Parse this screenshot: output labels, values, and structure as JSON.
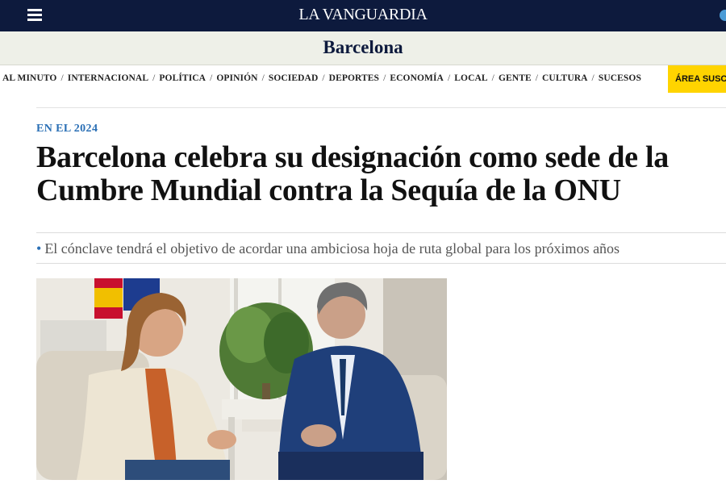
{
  "header": {
    "brand": "LA VANGUARDIA",
    "menu_icon": "hamburger-menu-icon",
    "user_icon": "user-account-icon",
    "bar_color": "#0d1a3d"
  },
  "section": {
    "title": "Barcelona"
  },
  "nav": {
    "items": [
      "AL MINUTO",
      "INTERNACIONAL",
      "POLÍTICA",
      "OPINIÓN",
      "SOCIEDAD",
      "DEPORTES",
      "ECONOMÍA",
      "LOCAL",
      "GENTE",
      "CULTURA",
      "SUCESOS"
    ],
    "separator": "/",
    "cta": "ÁREA SUSC",
    "cta_color": "#ffd400"
  },
  "article": {
    "kicker": "EN EL 2024",
    "headline": "Barcelona celebra su designación como sede de la Cumbre Mundial contra la Sequía de la ONU",
    "subtitle": "El cónclave tendrá el objetivo de acordar una ambiciosa hoja de ruta global para los próximos años",
    "accent_color": "#2a6fb5"
  }
}
